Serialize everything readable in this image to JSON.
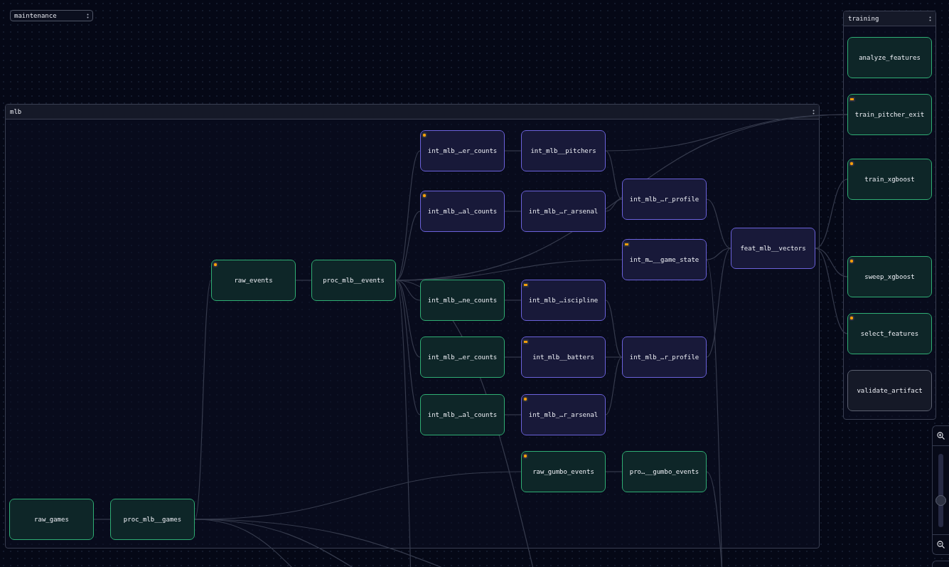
{
  "groups": [
    {
      "title": "maintenance",
      "collapsed": true
    },
    {
      "title": "mlb",
      "collapsed": false,
      "nodes": [
        {
          "label": "int_mlb_…er_counts",
          "color": "#6b62db",
          "kind": "dot"
        },
        {
          "label": "int_mlb__pitchers",
          "color": "#6b62db",
          "kind": "plain"
        },
        {
          "label": "int_mlb_…r_profile",
          "color": "#6b62db",
          "kind": "plain"
        },
        {
          "label": "int_mlb_…al_counts",
          "color": "#6b62db",
          "kind": "dot"
        },
        {
          "label": "int_mlb_…r_arsenal",
          "color": "#6b62db",
          "kind": "plain"
        },
        {
          "label": "feat_mlb__vectors",
          "color": "#6b62db",
          "kind": "plain"
        },
        {
          "label": "int_m…__game_state",
          "color": "#6b62db",
          "kind": "square"
        },
        {
          "label": "raw_events",
          "color": "#2fae74",
          "kind": "dot"
        },
        {
          "label": "proc_mlb__events",
          "color": "#2fae74",
          "kind": "plain"
        },
        {
          "label": "int_mlb_…ne_counts",
          "color": "#2fae74",
          "kind": "plain"
        },
        {
          "label": "int_mlb_…iscipline",
          "color": "#6b62db",
          "kind": "square"
        },
        {
          "label": "int_mlb_…er_counts",
          "color": "#2fae74",
          "kind": "plain"
        },
        {
          "label": "int_mlb__batters",
          "color": "#6b62db",
          "kind": "square"
        },
        {
          "label": "int_mlb_…r_profile",
          "color": "#6b62db",
          "kind": "plain"
        },
        {
          "label": "int_mlb_…al_counts",
          "color": "#2fae74",
          "kind": "plain"
        },
        {
          "label": "int_mlb_…r_arsenal",
          "color": "#6b62db",
          "kind": "dot"
        },
        {
          "label": "raw_gumbo_events",
          "color": "#2fae74",
          "kind": "dot"
        },
        {
          "label": "pro…__gumbo_events",
          "color": "#2fae74",
          "kind": "plain"
        },
        {
          "label": "raw_games",
          "color": "#2fae74",
          "kind": "plain"
        },
        {
          "label": "proc_mlb__games",
          "color": "#2fae74",
          "kind": "plain"
        }
      ]
    },
    {
      "title": "training",
      "collapsed": false,
      "nodes": [
        {
          "label": "analyze_features",
          "color": "#2fae74",
          "kind": "plain"
        },
        {
          "label": "train_pitcher_exit",
          "color": "#2fae74",
          "kind": "square"
        },
        {
          "label": "train_xgboost",
          "color": "#2fae74",
          "kind": "dot"
        },
        {
          "label": "sweep_xgboost",
          "color": "#2fae74",
          "kind": "dot"
        },
        {
          "label": "select_features",
          "color": "#2fae74",
          "kind": "dot"
        },
        {
          "label": "validate_artifact",
          "color": "#5b6070",
          "kind": "plain"
        }
      ]
    }
  ],
  "zoom_controls": {
    "level": 0.36
  }
}
